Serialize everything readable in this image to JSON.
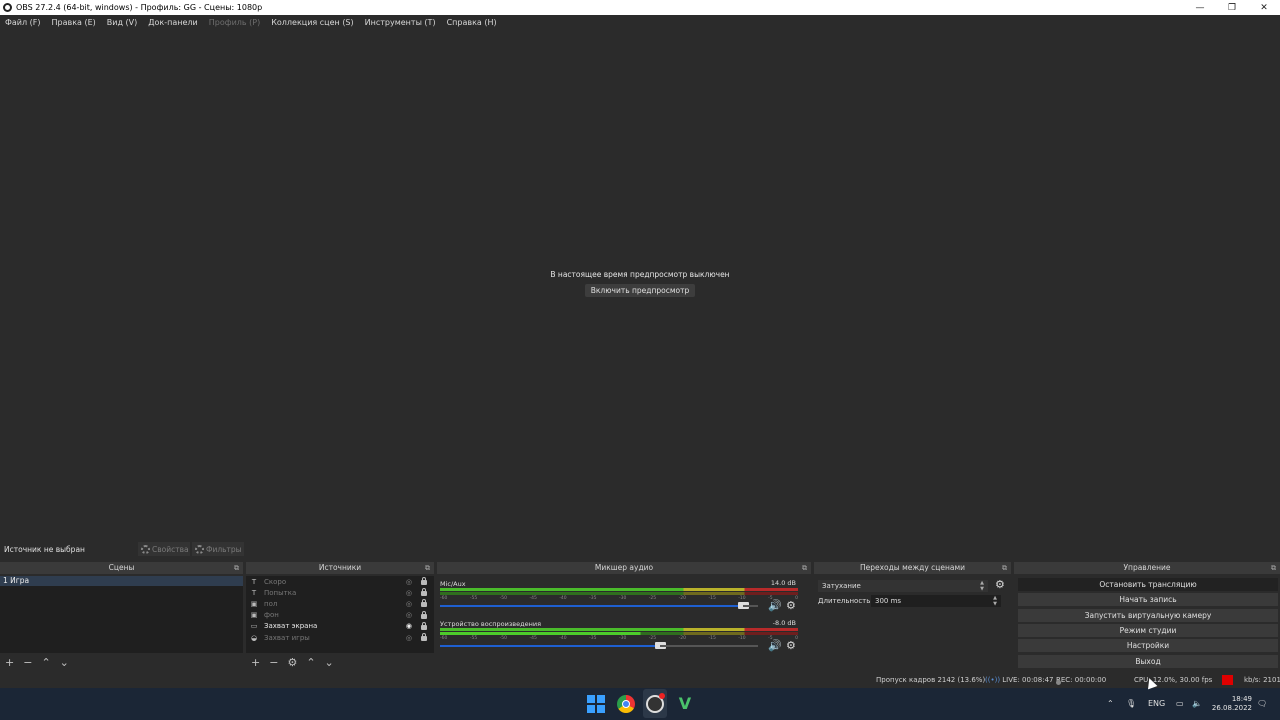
{
  "window": {
    "title": "OBS 27.2.4 (64-bit, windows) - Профиль: GG - Сцены: 1080p",
    "buttons": [
      "—",
      "❐",
      "✕"
    ]
  },
  "menu": [
    {
      "label": "Файл (F)",
      "disabled": false
    },
    {
      "label": "Правка (E)",
      "disabled": false
    },
    {
      "label": "Вид (V)",
      "disabled": false
    },
    {
      "label": "Док-панели",
      "disabled": false
    },
    {
      "label": "Профиль (P)",
      "disabled": true
    },
    {
      "label": "Коллекция сцен (S)",
      "disabled": false
    },
    {
      "label": "Инструменты (T)",
      "disabled": false
    },
    {
      "label": "Справка (H)",
      "disabled": false
    }
  ],
  "preview": {
    "message": "В настоящее время предпросмотр выключен",
    "enable_button": "Включить предпросмотр"
  },
  "source_toolbar": {
    "no_source": "Источник не выбран",
    "properties": "Свойства",
    "filters": "Фильтры"
  },
  "scenes": {
    "title": "Сцены",
    "items": [
      "Игра"
    ],
    "index_label": "1"
  },
  "sources": {
    "title": "Источники",
    "items": [
      {
        "name": "Скоро",
        "icon": "text-icon",
        "visible": false,
        "active": false
      },
      {
        "name": "Попытка",
        "icon": "text-icon",
        "visible": false,
        "active": false
      },
      {
        "name": "пол",
        "icon": "image-icon",
        "visible": false,
        "active": false
      },
      {
        "name": "фон",
        "icon": "image-icon",
        "visible": false,
        "active": false
      },
      {
        "name": "Захват экрана",
        "icon": "monitor-icon",
        "visible": true,
        "active": true
      },
      {
        "name": "Захват игры",
        "icon": "gamepad-icon",
        "visible": false,
        "active": false
      }
    ]
  },
  "mixer": {
    "title": "Микшер аудио",
    "ticks": [
      "-60",
      "-55",
      "-50",
      "-45",
      "-40",
      "-35",
      "-30",
      "-25",
      "-20",
      "-15",
      "-10",
      "-5",
      "0"
    ],
    "channels": [
      {
        "name": "Mic/Aux",
        "db": "14.0 dB",
        "volume": 0.97
      },
      {
        "name": "Устройство воспроизведения",
        "db": "-8.0 dB",
        "volume": 0.7
      }
    ]
  },
  "transitions": {
    "title": "Переходы между сценами",
    "selected": "Затухание",
    "duration_label": "Длительность",
    "duration_value": "300 ms"
  },
  "controls": {
    "title": "Управление",
    "buttons": [
      "Остановить трансляцию",
      "Начать запись",
      "Запустить виртуальную камеру",
      "Режим студии",
      "Настройки",
      "Выход"
    ]
  },
  "status": {
    "dropped": "Пропуск кадров 2142 (13.6%)",
    "live": "LIVE: 00:08:47",
    "rec": "REC: 00:00:00",
    "cpu": "CPU: 12.0%, 30.00 fps",
    "kbs": "kb/s: 2101",
    "indicator_color": "#e00000"
  },
  "taskbar": {
    "lang": "ENG",
    "time": "18:49",
    "date": "26.08.2022"
  }
}
